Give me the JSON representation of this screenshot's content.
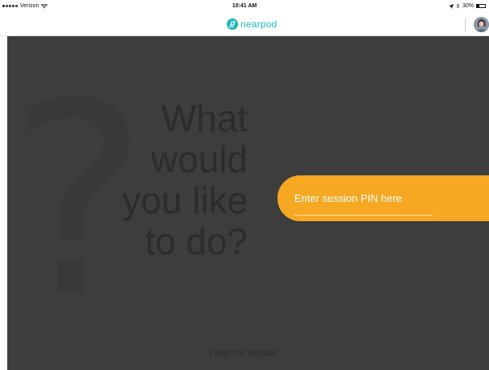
{
  "status_bar": {
    "carrier": "Verizon",
    "time": "10:41 AM",
    "battery": "30%",
    "battery_level": 0.3,
    "icons": [
      "signal-dots-icon",
      "wifi-icon",
      "location-arrow-icon",
      "bluetooth-icon",
      "battery-icon"
    ]
  },
  "header": {
    "logo_text": "nearpod",
    "brand_color": "#1db8b8",
    "avatar_icon": "user-avatar"
  },
  "main": {
    "background_color": "#3d3d3d",
    "headline_lines": [
      "What",
      "would",
      "you like",
      "to do?"
    ],
    "pin_panel": {
      "color": "#f6a823",
      "placeholder": "Enter session PIN here",
      "value": ""
    },
    "help_link": "Help me decide"
  }
}
